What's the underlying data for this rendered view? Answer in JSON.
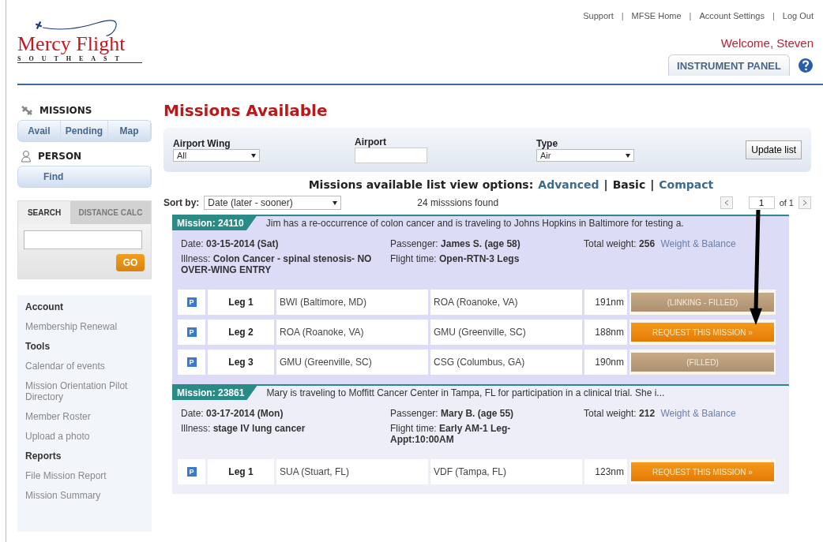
{
  "top_links": [
    "Support",
    "MFSE Home",
    "Account Settings",
    "Log Out"
  ],
  "link_separator": "|",
  "logo": {
    "name": "Mercy Flight",
    "tagline": "SOUTHEAST"
  },
  "welcome": "Welcome, Steven",
  "instrument_tab": "INSTRUMENT PANEL",
  "sidebar": {
    "missions_heading": "MISSIONS",
    "mission_tabs": [
      "Avail",
      "Pending",
      "Map"
    ],
    "person_heading": "PERSON",
    "find": "Find",
    "search_tabs": [
      {
        "label": "SEARCH",
        "selected": true
      },
      {
        "label": "DISTANCE CALC",
        "selected": false
      }
    ],
    "go": "GO",
    "links": [
      {
        "kind": "heading",
        "text": "Account"
      },
      {
        "kind": "link",
        "text": "Membership Renewal"
      },
      {
        "kind": "heading",
        "text": "Tools"
      },
      {
        "kind": "link",
        "text": "Calendar of events"
      },
      {
        "kind": "link",
        "text": "Mission Orientation Pilot Directory"
      },
      {
        "kind": "link",
        "text": "Member Roster"
      },
      {
        "kind": "link",
        "text": "Upload a photo"
      },
      {
        "kind": "heading",
        "text": "Reports"
      },
      {
        "kind": "link",
        "text": "File Mission Report"
      },
      {
        "kind": "link",
        "text": "Mission Summary"
      }
    ]
  },
  "title": "Missions Available",
  "filters": [
    {
      "kind": "select",
      "label": "Airport Wing",
      "value": "All"
    },
    {
      "kind": "text",
      "label": "Airport"
    },
    {
      "kind": "select",
      "label": "Type",
      "value": "Air"
    }
  ],
  "update_button": "Update list",
  "view_options": {
    "label": "Missions available list view options:",
    "separator": "|",
    "options": [
      {
        "label": "Advanced",
        "selected": false
      },
      {
        "label": "Basic",
        "selected": true
      },
      {
        "label": "Compact",
        "selected": false
      }
    ]
  },
  "sort": {
    "label": "Sort by:",
    "value": "Date (later - sooner)"
  },
  "count": "24 misssions found",
  "pager": {
    "page": "1",
    "of": "of 1"
  },
  "missions": [
    {
      "number": "Mission: 24110",
      "highlighted": true,
      "summary": "Jim has a re-occurrence of colon cancer and is traveling to Johns Hopkins in Baltimore for testing a.",
      "date": "Date: **03-15-2014 (Sat)**",
      "passenger": "Passenger: **James S. (age 58)**",
      "weight": "Total weight: **256**",
      "wb_link": "Weight & Balance",
      "illness": "Illness: **Colon Cancer - spinal stenosis- NO OVER-WING ENTRY**",
      "flight_time": "Flight time: **Open-RTN-3 Legs**",
      "legs": [
        {
          "badge": "P",
          "leg": "Leg 1",
          "from": "BWI (Baltimore, MD)",
          "to": "ROA (Roanoke, VA)",
          "distance": "191nm",
          "status": {
            "kind": "filled",
            "label": "(LINKING - FILLED)"
          }
        },
        {
          "badge": "P",
          "leg": "Leg 2",
          "from": "ROA (Roanoke, VA)",
          "to": "GMU (Greenville, SC)",
          "distance": "188nm",
          "status": {
            "kind": "request",
            "label": "REQUEST THIS MISSION »"
          }
        },
        {
          "badge": "P",
          "leg": "Leg 3",
          "from": "GMU (Greenville, SC)",
          "to": "CSG (Columbus, GA)",
          "distance": "190nm",
          "status": {
            "kind": "filled",
            "label": "(FILLED)"
          }
        }
      ]
    },
    {
      "number": "Mission: 23861",
      "highlighted": false,
      "summary": "Mary is traveling to Moffitt Cancer Center in Tampa, FL for participation in a clinical trial. She i...",
      "date": "Date: **03-17-2014 (Mon)**",
      "passenger": "Passenger: **Mary B. (age 55)**",
      "weight": "Total weight: **212**",
      "wb_link": "Weight & Balance",
      "illness": "Illness: **stage IV lung cancer**",
      "flight_time": "Flight time: **Early AM-1 Leg-Appt:10:00AM**",
      "legs": [
        {
          "badge": "P",
          "leg": "Leg 1",
          "from": "SUA (Stuart, FL)",
          "to": "VDF (Tampa, FL)",
          "distance": "123nm",
          "status": {
            "kind": "request",
            "label": "REQUEST THIS MISSION »"
          }
        }
      ]
    }
  ]
}
